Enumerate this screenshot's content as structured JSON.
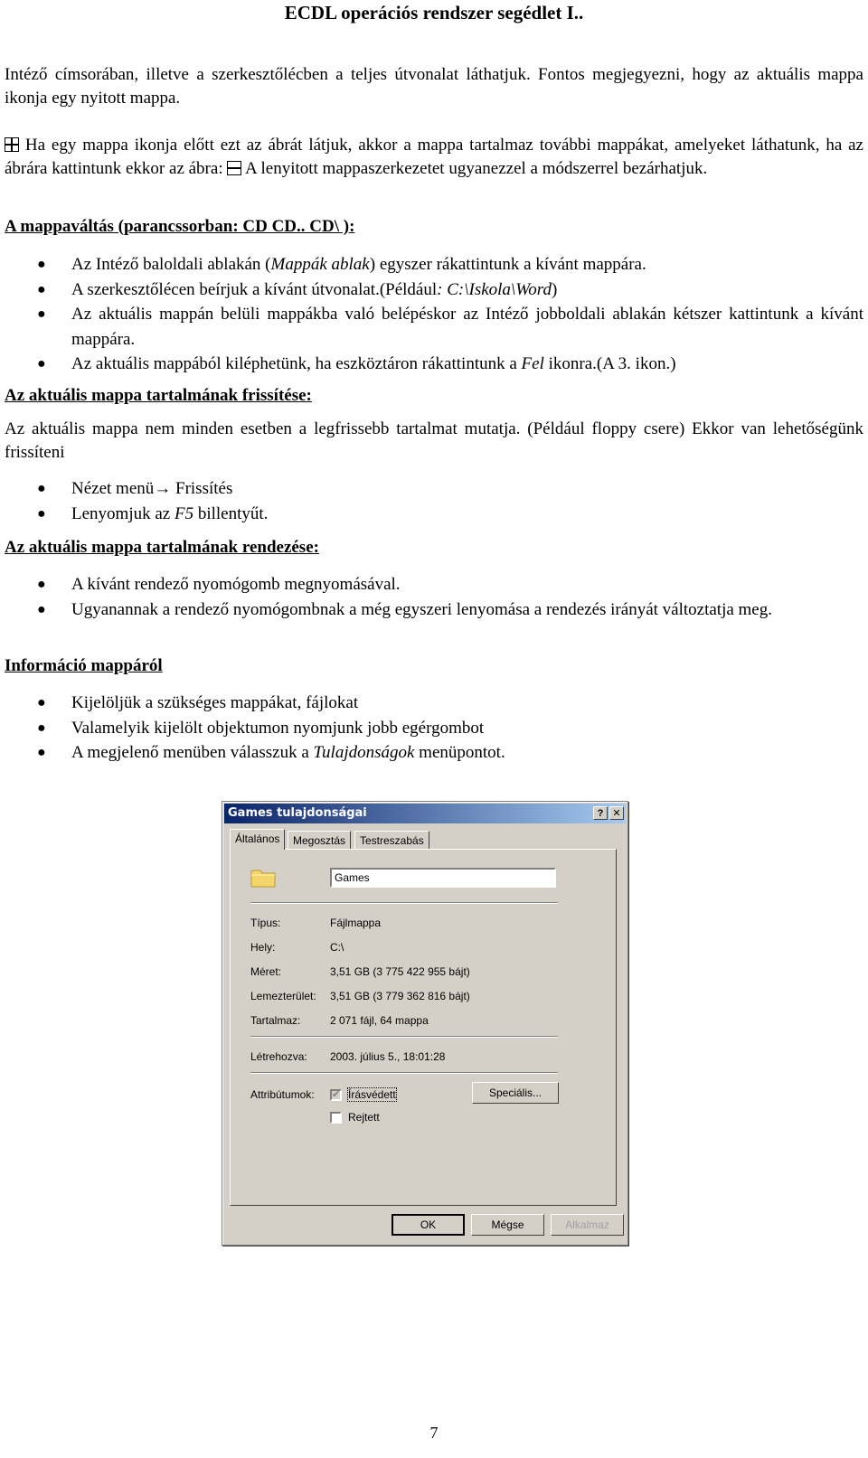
{
  "document": {
    "title": "ECDL operációs rendszer segédlet I..",
    "intro_paragraph": "Intéző címsorában, illetve a szerkesztőlécben a teljes útvonalat láthatjuk. Fontos megjegyezni, hogy az aktuális mappa ikonja egy nyitott mappa.",
    "expand_paragraph": {
      "part1": " Ha egy mappa ikonja előtt ezt az ábrát látjuk, akkor a mappa tartalmaz további mappákat, amelyeket láthatunk, ha az ábrára kattintunk ekkor az ábra: ",
      "part2": " A lenyitott mappaszerkezetet ugyanezzel a módszerrel bezárhatjuk.",
      "plus_icon": "tree-expand-plus-icon",
      "minus_icon": "tree-collapse-minus-icon"
    },
    "sections": [
      {
        "heading": "A mappaváltás (parancssorban: CD CD.. CD\\ ):",
        "bullets": [
          {
            "pre": "Az Intéző baloldali ablakán (",
            "em": "Mappák ablak",
            "post": ") egyszer rákattintunk a kívánt mappára."
          },
          {
            "pre": "A szerkesztőlécen beírjuk a kívánt útvonalat.(Például",
            "em": ": C:\\Iskola\\Word",
            "post": ")"
          },
          {
            "pre": "Az aktuális mappán belüli mappákba való belépéskor az Intéző jobboldali ablakán kétszer kattintunk a kívánt mappára.",
            "em": "",
            "post": ""
          },
          {
            "pre": "Az aktuális mappából kiléphetünk, ha eszköztáron rákattintunk a ",
            "em": "Fel",
            "post": " ikonra.(A 3. ikon.)"
          }
        ]
      },
      {
        "heading": "Az aktuális mappa tartalmának frissítése:",
        "paragraph": "Az aktuális mappa nem minden esetben a legfrissebb tartalmat mutatja. (Például floppy csere) Ekkor van lehetőségünk frissíteni",
        "bullets": [
          {
            "pre": "Nézet menü→ Frissítés",
            "em": "",
            "post": ""
          },
          {
            "pre": "Lenyomjuk az ",
            "em": "F5",
            "post": " billentyűt."
          }
        ]
      },
      {
        "heading": "Az aktuális mappa tartalmának rendezése:",
        "bullets": [
          {
            "pre": "A kívánt rendező nyomógomb megnyomásával.",
            "em": "",
            "post": ""
          },
          {
            "pre": "Ugyanannak a rendező nyomógombnak a még egyszeri lenyomása a rendezés irányát változtatja meg.",
            "em": "",
            "post": ""
          }
        ]
      },
      {
        "heading": "Információ mappáról",
        "bullets": [
          {
            "pre": "Kijelöljük a szükséges mappákat, fájlokat",
            "em": "",
            "post": ""
          },
          {
            "pre": "Valamelyik kijelölt objektumon nyomjunk jobb egérgombot",
            "em": "",
            "post": ""
          },
          {
            "pre": "A megjelenő menüben válasszuk a ",
            "em": "Tulajdonságok",
            "post": " menüpontot."
          }
        ]
      }
    ],
    "page_number": "7"
  },
  "dialog": {
    "title": "Games tulajdonságai",
    "help_button": "?",
    "close_button": "✕",
    "tabs": [
      {
        "label": "Általános",
        "active": true
      },
      {
        "label": "Megosztás",
        "active": false
      },
      {
        "label": "Testreszabás",
        "active": false
      }
    ],
    "name_value": "Games",
    "properties": [
      {
        "label": "Típus:",
        "value": "Fájlmappa"
      },
      {
        "label": "Hely:",
        "value": "C:\\"
      },
      {
        "label": "Méret:",
        "value": "3,51 GB (3 775 422 955 bájt)"
      },
      {
        "label": "Lemezterület:",
        "value": "3,51 GB (3 779 362 816 bájt)"
      },
      {
        "label": "Tartalmaz:",
        "value": "2 071 fájl, 64 mappa"
      }
    ],
    "created": {
      "label": "Létrehozva:",
      "value": "2003. július 5., 18:01:28"
    },
    "attributes": {
      "label": "Attribútumok:",
      "readonly": {
        "label": "Írásvédett",
        "checked": true
      },
      "hidden": {
        "label": "Rejtett",
        "checked": false
      },
      "advanced_button": "Speciális..."
    },
    "buttons": {
      "ok": "OK",
      "cancel": "Mégse",
      "apply": "Alkalmaz"
    },
    "colors": {
      "titlebar_start": "#0a246a",
      "titlebar_end": "#a6caf0",
      "face": "#d4d0c8"
    }
  }
}
